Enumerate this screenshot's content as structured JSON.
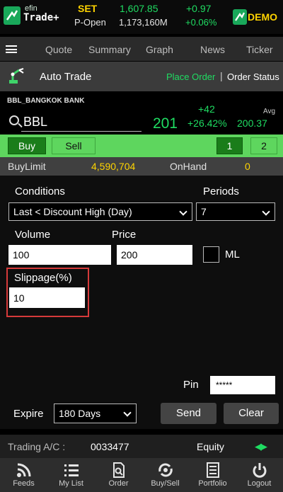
{
  "header": {
    "logo_top": "efin",
    "logo_bottom": "Trade+",
    "market_label": "SET",
    "market_state": "P-Open",
    "index_value": "1,607.85",
    "volume": "1,173,160M",
    "index_change": "+0.97",
    "index_change_pct": "+0.06%",
    "demo_label": "DEMO"
  },
  "nav": {
    "items": [
      "Quote",
      "Summary",
      "Graph",
      "News",
      "Ticker"
    ]
  },
  "autotrade": {
    "title": "Auto Trade",
    "place_order": "Place Order",
    "separator": "|",
    "order_status": "Order Status"
  },
  "symbol": {
    "full_name": "BBL_BANGKOK BANK",
    "code": "BBL",
    "last": "201",
    "change": "+42",
    "change_pct": "+26.42%",
    "avg_label": "Avg",
    "avg_value": "200.37"
  },
  "side": {
    "buy": "Buy",
    "sell": "Sell",
    "tab1": "1",
    "tab2": "2"
  },
  "limits": {
    "buy_limit_label": "BuyLimit",
    "buy_limit_value": "4,590,704",
    "on_hand_label": "OnHand",
    "on_hand_value": "0"
  },
  "form": {
    "conditions_label": "Conditions",
    "condition_value": "Last < Discount High (Day)",
    "periods_label": "Periods",
    "period_value": "7",
    "volume_label": "Volume",
    "volume_value": "100",
    "price_label": "Price",
    "price_value": "200",
    "ml_label": "ML",
    "slippage_label": "Slippage(%)",
    "slippage_value": "10",
    "pin_label": "Pin",
    "pin_value": "*****",
    "expire_label": "Expire",
    "expire_value": "180 Days",
    "send": "Send",
    "clear": "Clear"
  },
  "account": {
    "label": "Trading A/C :",
    "number": "0033477",
    "type": "Equity"
  },
  "bottom_nav": {
    "feeds": "Feeds",
    "mylist": "My List",
    "order": "Order",
    "buysell": "Buy/Sell",
    "portfolio": "Portfolio",
    "logout": "Logout"
  },
  "colors": {
    "accent_green": "#1fdc62",
    "bar_green": "#5ed65e",
    "highlight_red": "#d63a3a",
    "yellow": "#ffd400"
  }
}
